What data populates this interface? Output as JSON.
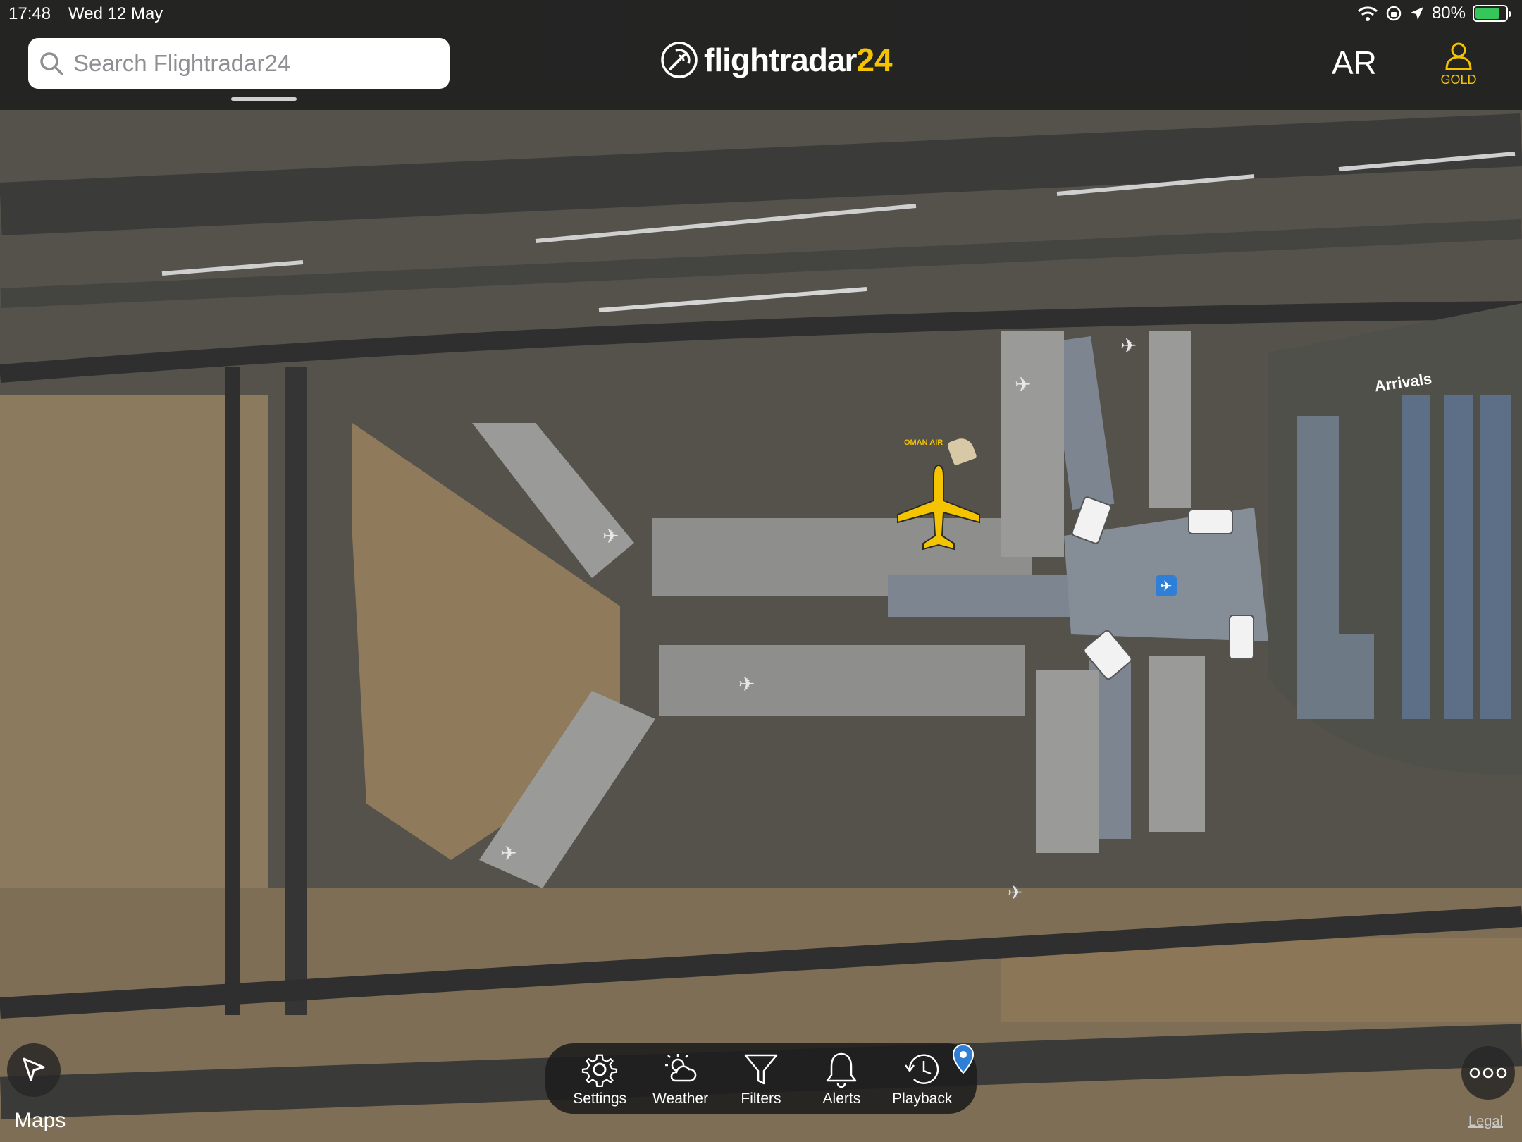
{
  "status_bar": {
    "time": "17:48",
    "date": "Wed 12 May",
    "battery": "80%",
    "icons": [
      "wifi-icon",
      "orientation-lock-icon",
      "location-arrow-icon",
      "battery-charging-icon"
    ]
  },
  "header": {
    "search_placeholder": "Search Flightradar24",
    "logo_word": "flightradar",
    "logo_num": "24",
    "ar_label": "AR",
    "account_label": "GOLD"
  },
  "map": {
    "label_arrivals": "Arrivals",
    "selected_flight_airline": "OMAN AIR",
    "attribution": "Maps",
    "legal": "Legal",
    "accent_yellow": "#f4c400",
    "airport_badge_color": "#2f7fd6"
  },
  "toolbar": {
    "items": [
      {
        "label": "Settings",
        "icon": "gear-icon"
      },
      {
        "label": "Weather",
        "icon": "weather-icon"
      },
      {
        "label": "Filters",
        "icon": "filter-icon"
      },
      {
        "label": "Alerts",
        "icon": "bell-icon"
      },
      {
        "label": "Playback",
        "icon": "history-icon"
      }
    ]
  }
}
